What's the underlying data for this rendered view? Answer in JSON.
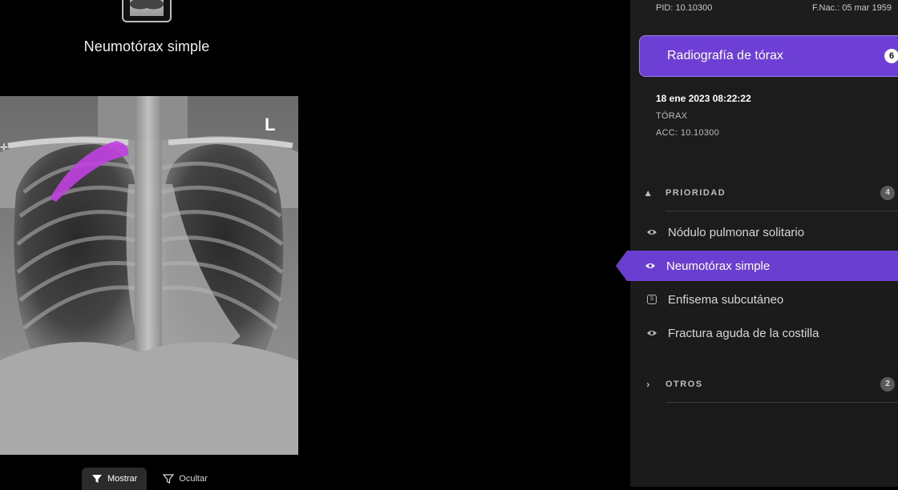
{
  "viewer": {
    "finding_title": "Neumotórax simple",
    "laterality_marker": "L",
    "overlay_color": "#c040e0",
    "toggle": {
      "show_label": "Mostrar",
      "hide_label": "Ocultar",
      "selected": "Mostrar"
    }
  },
  "patient": {
    "pid": "PID: 10.10300",
    "dob": "F.Nac.: 05 mar 1959"
  },
  "study": {
    "name": "Radiografía de tórax",
    "count": "6",
    "date": "18 ene 2023 08:22:22",
    "body_part": "TÓRAX",
    "accession": "ACC: 10.10300"
  },
  "groups": {
    "priority": {
      "label": "PRIORIDAD",
      "count": "4",
      "icon": "warning-icon",
      "items": [
        {
          "label": "Nódulo pulmonar solitario",
          "icon": "eye-icon"
        },
        {
          "label": "Neumotórax simple",
          "icon": "eye-icon",
          "active": true
        },
        {
          "label": "Enfisema subcutáneo",
          "icon": "box-icon",
          "icon_text": "S"
        },
        {
          "label": "Fractura aguda de la costilla",
          "icon": "eye-icon"
        }
      ]
    },
    "others": {
      "label": "OTROS",
      "count": "2",
      "icon": "chevron-right-icon"
    }
  },
  "colors": {
    "accent": "#6b3ed2",
    "panel_bg": "#1c1c1c"
  }
}
